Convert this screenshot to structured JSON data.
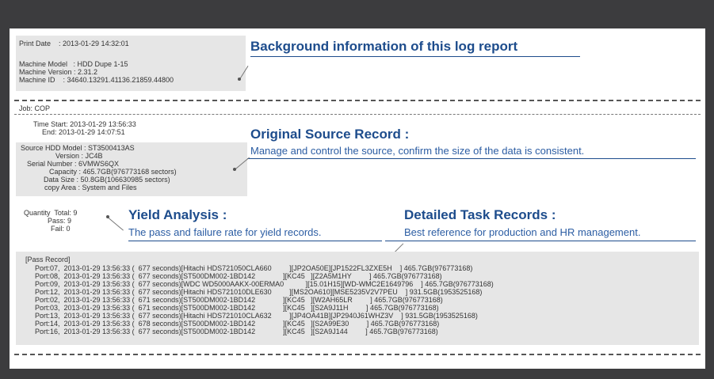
{
  "background": {
    "print_date": "Print Date    : 2013-01-29 14:32:01",
    "machine_model": "Machine Model   : HDD Dupe 1-15",
    "machine_version": "Machine Version : 2.31.2",
    "machine_id": "Machine ID    : 34640.13291.41136.21859.44800"
  },
  "callouts": {
    "background_title": "Background information of this log report",
    "original_title": "Original Source Record :",
    "original_sub": "Manage and control the source, confirm the size of the data is consistent.",
    "yield_title": "Yield Analysis :",
    "yield_sub": "The pass and failure rate for yield records.",
    "detailed_title": "Detailed Task Records :",
    "detailed_sub": "Best reference for production and HR management."
  },
  "job": {
    "job": "Job: COP",
    "time_start": "Time Start: 2013-01-29 13:56:33",
    "time_end": "End: 2013-01-29 14:07:51"
  },
  "source": {
    "model": "Source HDD Model : ST3500413AS",
    "version": "Version : JC4B",
    "serial": "Serial Number : 6VMWS6QX",
    "capacity": "Capacity : 465.7GB(976773168 sectors)",
    "data_size": "Data Size : 50.8GB(106630985 sectors)",
    "copy_area": "copy Area : System and Files"
  },
  "quantity": {
    "total": "Quantity  Total: 9",
    "pass": "Pass: 9",
    "fail": "Fail: 0"
  },
  "pass_record": {
    "header": "[Pass Record]",
    "rows": [
      "Port:07,  2013-01-29 13:56:33 (  677 seconds)[Hitachi HDS721050CLA660         ][JP2OA50E][JP1522FL3ZXE5H    ] 465.7GB(976773168)",
      "Port:08,  2013-01-29 13:56:33 (  677 seconds)[ST500DM002-1BD142              ][KC45   ][Z2A5M1HY         ] 465.7GB(976773168)",
      "Port:09,  2013-01-29 13:56:33 (  677 seconds)[WDC WD5000AAKX-00ERMA0           ][15.01H15][WD-WMC2E1649796    ] 465.7GB(976773168)",
      "Port:12,  2013-01-29 13:56:33 (  677 seconds)[Hitachi HDS721010DLE630         ][MS2OA610][MSE5235V2V7PEU    ] 931.5GB(1953525168)",
      "Port:02,  2013-01-29 13:56:33 (  671 seconds)[ST500DM002-1BD142              ][KC45   ][W2AH65LR         ] 465.7GB(976773168)",
      "Port:03,  2013-01-29 13:56:33 (  671 seconds)[ST500DM002-1BD142              ][KC45   ][S2A9J11H         ] 465.7GB(976773168)",
      "Port:13,  2013-01-29 13:56:33 (  677 seconds)[Hitachi HDS721010CLA632         ][JP4OA41B][JP2940J61WHZ3V    ] 931.5GB(1953525168)",
      "Port:14,  2013-01-29 13:56:33 (  678 seconds)[ST500DM002-1BD142              ][KC45   ][S2A99E30         ] 465.7GB(976773168)",
      "Port:16,  2013-01-29 13:56:33 (  677 seconds)[ST500DM002-1BD142              ][KC45   ][S2A9J144         ] 465.7GB(976773168)"
    ]
  }
}
